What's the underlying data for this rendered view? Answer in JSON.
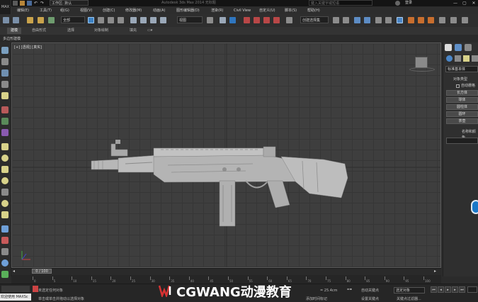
{
  "titlebar": {
    "app_logo": "MAX",
    "workspace": "工作区: 默认",
    "title": "Autodesk 3ds Max 2014  无标题",
    "search_placeholder": "键入关键字或短语",
    "login": "登录",
    "window_buttons": [
      "—",
      "▢",
      "✕"
    ]
  },
  "menu": [
    "编辑(E)",
    "工具(T)",
    "组(G)",
    "视图(V)",
    "创建(C)",
    "修改器(M)",
    "动画(A)",
    "图形编辑器(D)",
    "渲染(R)",
    "Civil View",
    "自定义(U)",
    "脚本(S)",
    "帮助(H)"
  ],
  "toolbar": {
    "filter_dd": "全部",
    "refcoord_dd": "视图",
    "selection_set_dd": "创建选择集"
  },
  "ribbon": {
    "tabs": [
      "建模",
      "自由形式",
      "选择",
      "对象绘制",
      "填充"
    ],
    "sub_label": "多边形建模"
  },
  "viewport": {
    "label": "[+] [透视] [真实]"
  },
  "command_panel": {
    "category": "标准基本体",
    "section_object_type": "对象类型",
    "autogrid": "自动栅格",
    "buttons": [
      "长方体",
      "球体",
      "圆柱体",
      "圆环",
      "茶壶"
    ],
    "section_name_color": "名称和颜色"
  },
  "timeline": {
    "frame": "0 / 100",
    "ticks": [
      "0",
      "5",
      "10",
      "15",
      "20",
      "25",
      "30",
      "35",
      "40",
      "45",
      "50",
      "55",
      "60",
      "65",
      "70",
      "75",
      "80",
      "85",
      "90",
      "95",
      "100"
    ]
  },
  "status": {
    "welcome": "欢迎使用 MAXSc",
    "selection": "未选定任何对象",
    "prompt": "单击或单击并拖动以选择对象",
    "add_time_tag": "添加时间标记",
    "grid": "= 25.4cm",
    "autokey": "自动关键点",
    "setkey": "设置关键点",
    "key_dd": "选定对象",
    "key_filter": "关键点过滤器...",
    "watermark": "CGWANG动漫教育"
  },
  "colors": {
    "accent_blue": "#1b78c8",
    "viewport_bg": "#3e3e3e",
    "model_gray": "#b8b8b8"
  }
}
